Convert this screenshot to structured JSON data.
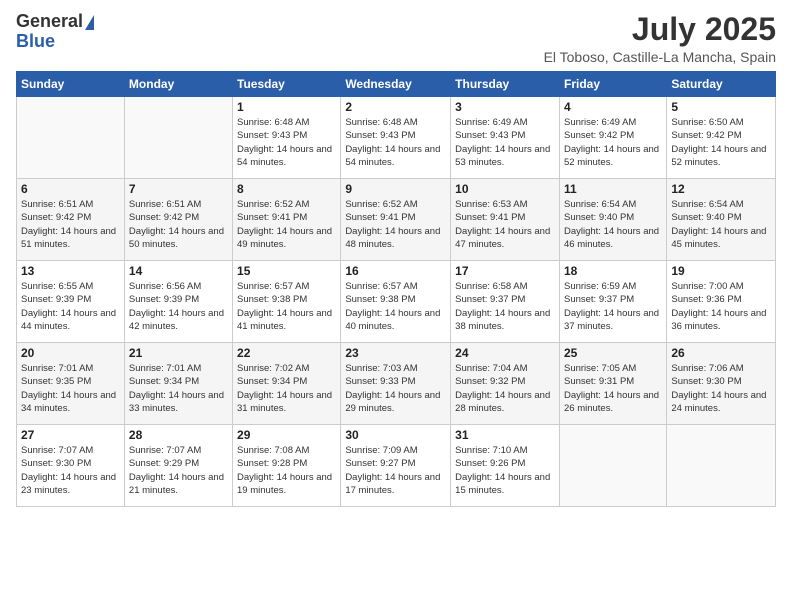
{
  "header": {
    "logo_general": "General",
    "logo_blue": "Blue",
    "title": "July 2025",
    "location": "El Toboso, Castille-La Mancha, Spain"
  },
  "weekdays": [
    "Sunday",
    "Monday",
    "Tuesday",
    "Wednesday",
    "Thursday",
    "Friday",
    "Saturday"
  ],
  "weeks": [
    [
      {
        "day": "",
        "sunrise": "",
        "sunset": "",
        "daylight": ""
      },
      {
        "day": "",
        "sunrise": "",
        "sunset": "",
        "daylight": ""
      },
      {
        "day": "1",
        "sunrise": "Sunrise: 6:48 AM",
        "sunset": "Sunset: 9:43 PM",
        "daylight": "Daylight: 14 hours and 54 minutes."
      },
      {
        "day": "2",
        "sunrise": "Sunrise: 6:48 AM",
        "sunset": "Sunset: 9:43 PM",
        "daylight": "Daylight: 14 hours and 54 minutes."
      },
      {
        "day": "3",
        "sunrise": "Sunrise: 6:49 AM",
        "sunset": "Sunset: 9:43 PM",
        "daylight": "Daylight: 14 hours and 53 minutes."
      },
      {
        "day": "4",
        "sunrise": "Sunrise: 6:49 AM",
        "sunset": "Sunset: 9:42 PM",
        "daylight": "Daylight: 14 hours and 52 minutes."
      },
      {
        "day": "5",
        "sunrise": "Sunrise: 6:50 AM",
        "sunset": "Sunset: 9:42 PM",
        "daylight": "Daylight: 14 hours and 52 minutes."
      }
    ],
    [
      {
        "day": "6",
        "sunrise": "Sunrise: 6:51 AM",
        "sunset": "Sunset: 9:42 PM",
        "daylight": "Daylight: 14 hours and 51 minutes."
      },
      {
        "day": "7",
        "sunrise": "Sunrise: 6:51 AM",
        "sunset": "Sunset: 9:42 PM",
        "daylight": "Daylight: 14 hours and 50 minutes."
      },
      {
        "day": "8",
        "sunrise": "Sunrise: 6:52 AM",
        "sunset": "Sunset: 9:41 PM",
        "daylight": "Daylight: 14 hours and 49 minutes."
      },
      {
        "day": "9",
        "sunrise": "Sunrise: 6:52 AM",
        "sunset": "Sunset: 9:41 PM",
        "daylight": "Daylight: 14 hours and 48 minutes."
      },
      {
        "day": "10",
        "sunrise": "Sunrise: 6:53 AM",
        "sunset": "Sunset: 9:41 PM",
        "daylight": "Daylight: 14 hours and 47 minutes."
      },
      {
        "day": "11",
        "sunrise": "Sunrise: 6:54 AM",
        "sunset": "Sunset: 9:40 PM",
        "daylight": "Daylight: 14 hours and 46 minutes."
      },
      {
        "day": "12",
        "sunrise": "Sunrise: 6:54 AM",
        "sunset": "Sunset: 9:40 PM",
        "daylight": "Daylight: 14 hours and 45 minutes."
      }
    ],
    [
      {
        "day": "13",
        "sunrise": "Sunrise: 6:55 AM",
        "sunset": "Sunset: 9:39 PM",
        "daylight": "Daylight: 14 hours and 44 minutes."
      },
      {
        "day": "14",
        "sunrise": "Sunrise: 6:56 AM",
        "sunset": "Sunset: 9:39 PM",
        "daylight": "Daylight: 14 hours and 42 minutes."
      },
      {
        "day": "15",
        "sunrise": "Sunrise: 6:57 AM",
        "sunset": "Sunset: 9:38 PM",
        "daylight": "Daylight: 14 hours and 41 minutes."
      },
      {
        "day": "16",
        "sunrise": "Sunrise: 6:57 AM",
        "sunset": "Sunset: 9:38 PM",
        "daylight": "Daylight: 14 hours and 40 minutes."
      },
      {
        "day": "17",
        "sunrise": "Sunrise: 6:58 AM",
        "sunset": "Sunset: 9:37 PM",
        "daylight": "Daylight: 14 hours and 38 minutes."
      },
      {
        "day": "18",
        "sunrise": "Sunrise: 6:59 AM",
        "sunset": "Sunset: 9:37 PM",
        "daylight": "Daylight: 14 hours and 37 minutes."
      },
      {
        "day": "19",
        "sunrise": "Sunrise: 7:00 AM",
        "sunset": "Sunset: 9:36 PM",
        "daylight": "Daylight: 14 hours and 36 minutes."
      }
    ],
    [
      {
        "day": "20",
        "sunrise": "Sunrise: 7:01 AM",
        "sunset": "Sunset: 9:35 PM",
        "daylight": "Daylight: 14 hours and 34 minutes."
      },
      {
        "day": "21",
        "sunrise": "Sunrise: 7:01 AM",
        "sunset": "Sunset: 9:34 PM",
        "daylight": "Daylight: 14 hours and 33 minutes."
      },
      {
        "day": "22",
        "sunrise": "Sunrise: 7:02 AM",
        "sunset": "Sunset: 9:34 PM",
        "daylight": "Daylight: 14 hours and 31 minutes."
      },
      {
        "day": "23",
        "sunrise": "Sunrise: 7:03 AM",
        "sunset": "Sunset: 9:33 PM",
        "daylight": "Daylight: 14 hours and 29 minutes."
      },
      {
        "day": "24",
        "sunrise": "Sunrise: 7:04 AM",
        "sunset": "Sunset: 9:32 PM",
        "daylight": "Daylight: 14 hours and 28 minutes."
      },
      {
        "day": "25",
        "sunrise": "Sunrise: 7:05 AM",
        "sunset": "Sunset: 9:31 PM",
        "daylight": "Daylight: 14 hours and 26 minutes."
      },
      {
        "day": "26",
        "sunrise": "Sunrise: 7:06 AM",
        "sunset": "Sunset: 9:30 PM",
        "daylight": "Daylight: 14 hours and 24 minutes."
      }
    ],
    [
      {
        "day": "27",
        "sunrise": "Sunrise: 7:07 AM",
        "sunset": "Sunset: 9:30 PM",
        "daylight": "Daylight: 14 hours and 23 minutes."
      },
      {
        "day": "28",
        "sunrise": "Sunrise: 7:07 AM",
        "sunset": "Sunset: 9:29 PM",
        "daylight": "Daylight: 14 hours and 21 minutes."
      },
      {
        "day": "29",
        "sunrise": "Sunrise: 7:08 AM",
        "sunset": "Sunset: 9:28 PM",
        "daylight": "Daylight: 14 hours and 19 minutes."
      },
      {
        "day": "30",
        "sunrise": "Sunrise: 7:09 AM",
        "sunset": "Sunset: 9:27 PM",
        "daylight": "Daylight: 14 hours and 17 minutes."
      },
      {
        "day": "31",
        "sunrise": "Sunrise: 7:10 AM",
        "sunset": "Sunset: 9:26 PM",
        "daylight": "Daylight: 14 hours and 15 minutes."
      },
      {
        "day": "",
        "sunrise": "",
        "sunset": "",
        "daylight": ""
      },
      {
        "day": "",
        "sunrise": "",
        "sunset": "",
        "daylight": ""
      }
    ]
  ]
}
